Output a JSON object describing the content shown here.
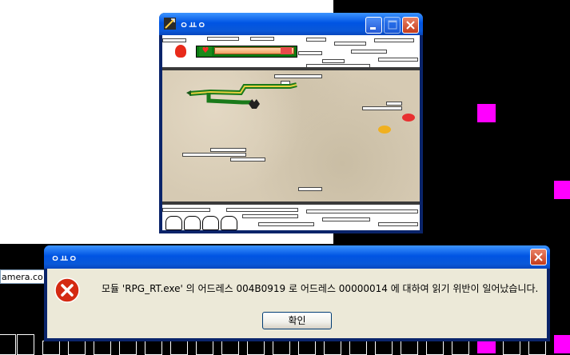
{
  "game_window": {
    "title": "ㅇㅛㅇ",
    "minimize_label": "",
    "maximize_label": "",
    "close_label": ""
  },
  "error_dialog": {
    "title": "ㅇㅛㅇ",
    "message": "모듈 'RPG_RT.exe' 의 어드레스 004B0919 로 어드레스 00000014 에 대하여 읽기 위반이 일어났습니다.",
    "ok_label": "확인"
  },
  "taskbar": {
    "partial_label": "amera.co"
  },
  "colors": {
    "desktop_magenta": "#ff00ff",
    "xp_title_blue": "#0054e3",
    "dialog_face": "#ece9d8"
  }
}
